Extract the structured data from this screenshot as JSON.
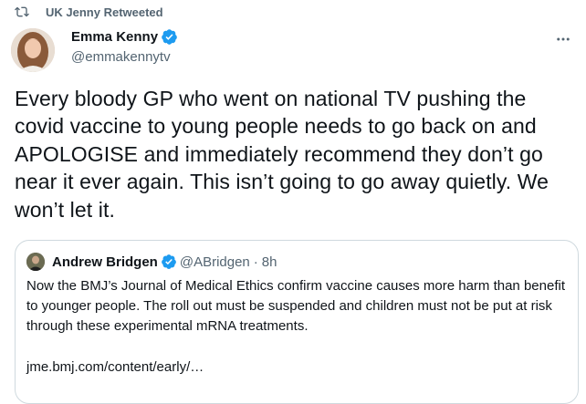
{
  "retweet": {
    "label": "UK Jenny Retweeted",
    "icon": "retweet-icon"
  },
  "tweet": {
    "author": {
      "name": "Emma Kenny",
      "handle": "@emmakennytv",
      "verified": true
    },
    "text": "Every bloody GP who went on national TV pushing the covid vaccine to young people needs to go back on and APOLOGISE and immediately recommend they don’t go near it ever again. This isn’t going to go away quietly. We won’t let it.",
    "more_icon": "more-icon"
  },
  "quote": {
    "author": {
      "name": "Andrew Bridgen",
      "handle": "@ABridgen",
      "time": "8h",
      "verified": true
    },
    "separator": "·",
    "text": "Now the BMJ’s Journal of Medical Ethics confirm vaccine causes more harm than benefit to younger people. The roll out must be suspended and children must not be put at risk through these experimental mRNA treatments.",
    "link": "jme.bmj.com/content/early/…"
  },
  "colors": {
    "text": "#0f1419",
    "secondary": "#536471",
    "verified": "#1d9bf0",
    "border": "#cfd9de"
  }
}
